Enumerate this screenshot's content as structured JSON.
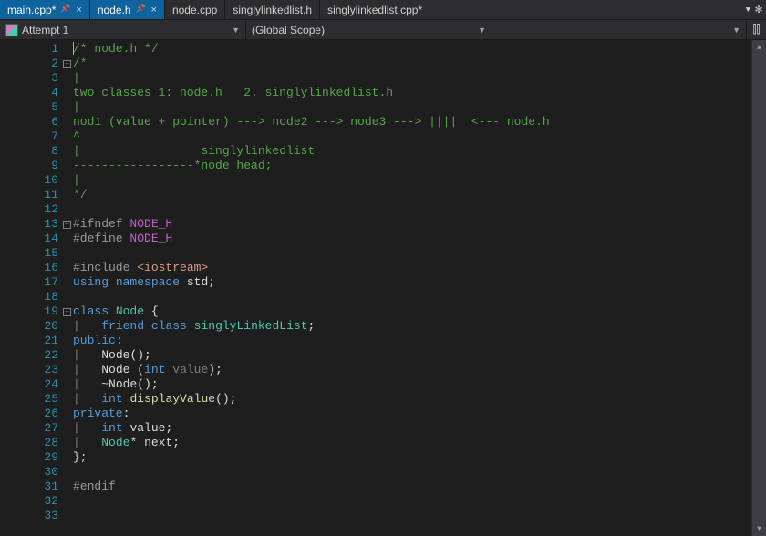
{
  "tabs": [
    {
      "label": "main.cpp*",
      "active": true,
      "pinned": true,
      "closeable": true
    },
    {
      "label": "node.h",
      "active": true,
      "pinned": true,
      "closeable": true
    },
    {
      "label": "node.cpp",
      "active": false,
      "pinned": false,
      "closeable": false
    },
    {
      "label": "singlylinkedlist.h",
      "active": false,
      "pinned": false,
      "closeable": false
    },
    {
      "label": "singlylinkedlist.cpp*",
      "active": false,
      "pinned": false,
      "closeable": false
    }
  ],
  "tabbar_right": {
    "dropdown_glyph": "▾",
    "gear_glyph": "✻"
  },
  "navbar": {
    "scope1": "Attempt 1",
    "scope2": "(Global Scope)",
    "split_glyph": "⫿⫿"
  },
  "code_lines": [
    {
      "n": 1,
      "fold": "",
      "html": "<span class='c-comment cursor-line'>/* node.h */</span>"
    },
    {
      "n": 2,
      "fold": "box",
      "html": "<span class='c-comment'>/*</span>"
    },
    {
      "n": 3,
      "fold": "line",
      "html": "<span class='c-comment'>|</span>"
    },
    {
      "n": 4,
      "fold": "line",
      "html": "<span class='c-comment'>two classes 1: node.h   2. singlylinkedlist.h</span>"
    },
    {
      "n": 5,
      "fold": "line",
      "html": "<span class='c-comment'>|</span>"
    },
    {
      "n": 6,
      "fold": "line",
      "html": "<span class='c-comment'>nod1 (value + pointer) ---&gt; node2 ---&gt; node3 ---&gt; ||||  &lt;--- node.h</span>"
    },
    {
      "n": 7,
      "fold": "line",
      "html": "<span class='c-comment'>^</span>"
    },
    {
      "n": 8,
      "fold": "line",
      "html": "<span class='c-comment'>|                 singlylinkedlist</span>"
    },
    {
      "n": 9,
      "fold": "line",
      "html": "<span class='c-comment'>-----------------*node head;</span>"
    },
    {
      "n": 10,
      "fold": "line",
      "html": "<span class='c-comment'>|</span>"
    },
    {
      "n": 11,
      "fold": "line",
      "html": "<span class='c-comment'>*/</span>"
    },
    {
      "n": 12,
      "fold": "",
      "html": ""
    },
    {
      "n": 13,
      "fold": "box",
      "html": "<span class='c-macro'>#ifndef </span><span class='c-macroname'>NODE_H</span>"
    },
    {
      "n": 14,
      "fold": "line",
      "html": "<span class='c-macro'>#define </span><span class='c-macroname'>NODE_H</span>"
    },
    {
      "n": 15,
      "fold": "line",
      "html": ""
    },
    {
      "n": 16,
      "fold": "line",
      "html": "<span class='c-macro'>#include </span><span class='c-string'>&lt;iostream&gt;</span>"
    },
    {
      "n": 17,
      "fold": "line",
      "html": "<span class='c-keyword'>using</span> <span class='c-keyword'>namespace</span> <span class='c-default'>std</span><span class='c-punc'>;</span>"
    },
    {
      "n": 18,
      "fold": "line",
      "html": ""
    },
    {
      "n": 19,
      "fold": "box2",
      "html": "<span class='c-keyword'>class</span> <span class='c-type'>Node</span> <span class='c-punc'>{</span>"
    },
    {
      "n": 20,
      "fold": "line2",
      "html": "<span class='c-fade'>|   </span><span class='c-keyword'>friend</span> <span class='c-keyword'>class</span> <span class='c-type'>singlyLinkedList</span><span class='c-punc'>;</span>"
    },
    {
      "n": 21,
      "fold": "line2",
      "html": "<span class='c-keyword'>public</span><span class='c-punc'>:</span>"
    },
    {
      "n": 22,
      "fold": "line2",
      "html": "<span class='c-fade'>|   </span><span class='c-default'>Node</span><span class='c-punc'>();</span>"
    },
    {
      "n": 23,
      "fold": "line2",
      "html": "<span class='c-fade'>|   </span><span class='c-default'>Node </span><span class='c-punc'>(</span><span class='c-keyword'>int</span> <span class='c-fade'>value</span><span class='c-punc'>);</span>"
    },
    {
      "n": 24,
      "fold": "line2",
      "html": "<span class='c-fade'>|   </span><span class='c-default'>~Node</span><span class='c-punc'>();</span>"
    },
    {
      "n": 25,
      "fold": "line2",
      "html": "<span class='c-fade'>|   </span><span class='c-keyword'>int</span> <span class='c-func'>displayValue</span><span class='c-punc'>();</span>"
    },
    {
      "n": 26,
      "fold": "line2",
      "html": "<span class='c-keyword'>private</span><span class='c-punc'>:</span>"
    },
    {
      "n": 27,
      "fold": "line2",
      "html": "<span class='c-fade'>|   </span><span class='c-keyword'>int</span> <span class='c-default'>value</span><span class='c-punc'>;</span>"
    },
    {
      "n": 28,
      "fold": "line2",
      "html": "<span class='c-fade'>|   </span><span class='c-type'>Node</span><span class='c-punc'>*</span> <span class='c-default'>next</span><span class='c-punc'>;</span>"
    },
    {
      "n": 29,
      "fold": "line2",
      "html": "<span class='c-punc'>};</span>"
    },
    {
      "n": 30,
      "fold": "line",
      "html": ""
    },
    {
      "n": 31,
      "fold": "line",
      "html": "<span class='c-macro'>#endif</span>"
    },
    {
      "n": 32,
      "fold": "",
      "html": ""
    },
    {
      "n": 33,
      "fold": "",
      "html": ""
    }
  ]
}
